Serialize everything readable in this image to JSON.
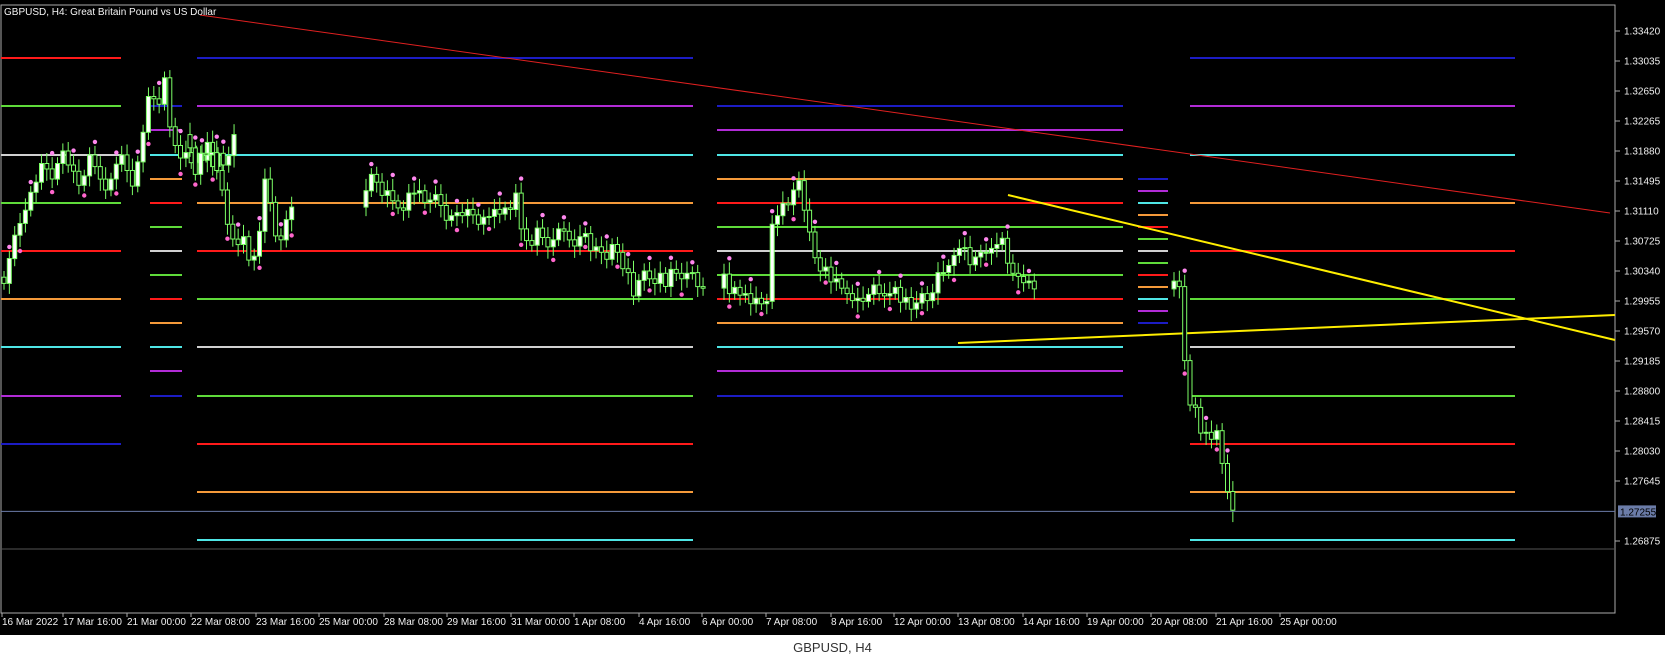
{
  "chart_data": {
    "type": "candlestick",
    "title": "GBPUSD, H4:  Great Britain Pound vs US Dollar",
    "caption": "GBPUSD, H4",
    "current_price": "1.27255",
    "y_ticks": [
      1.3342,
      1.33035,
      1.3265,
      1.32265,
      1.3188,
      1.31495,
      1.3111,
      1.30725,
      1.3034,
      1.29955,
      1.2957,
      1.29185,
      1.288,
      1.28415,
      1.2803,
      1.27645,
      1.26875
    ],
    "y_tick_labels": [
      "1.33420",
      "1.33035",
      "1.32650",
      "1.32265",
      "1.31880",
      "1.31495",
      "1.31110",
      "1.30725",
      "1.30340",
      "1.29955",
      "1.29570",
      "1.29185",
      "1.28800",
      "1.28415",
      "1.28030",
      "1.27645",
      "1.26875"
    ],
    "ylim": [
      1.2655,
      1.3365
    ],
    "x_labels": [
      "16 Mar 2022",
      "17 Mar 16:00",
      "21 Mar 00:00",
      "22 Mar 08:00",
      "23 Mar 16:00",
      "25 Mar 00:00",
      "28 Mar 08:00",
      "29 Mar 16:00",
      "31 Mar 00:00",
      "1 Apr 08:00",
      "4 Apr 16:00",
      "6 Apr 00:00",
      "7 Apr 08:00",
      "8 Apr 16:00",
      "12 Apr 00:00",
      "13 Apr 08:00",
      "14 Apr 16:00",
      "19 Apr 00:00",
      "20 Apr 08:00",
      "21 Apr 16:00",
      "25 Apr 00:00"
    ],
    "closes": [
      1.3018,
      1.305,
      1.308,
      1.3095,
      1.3112,
      1.3135,
      1.3148,
      1.3172,
      1.3165,
      1.3152,
      1.3172,
      1.3188,
      1.317,
      1.3162,
      1.3144,
      1.3156,
      1.3183,
      1.3168,
      1.3152,
      1.3138,
      1.3152,
      1.3171,
      1.3183,
      1.3163,
      1.3143,
      1.3174,
      1.3212,
      1.3258,
      1.3255,
      1.3248,
      1.3282,
      1.3219,
      1.3195,
      1.3179,
      1.3186,
      1.3173,
      1.3185,
      1.3176,
      1.3199,
      1.3168,
      1.3185,
      1.317,
      1.3182,
      1.3209,
      1.3192,
      1.3158,
      1.3185,
      1.3183,
      1.3186,
      1.3163,
      1.3138,
      1.3094,
      1.3075,
      1.3068,
      1.3078,
      1.3048,
      1.3053,
      1.3085,
      1.3152,
      1.3122,
      1.3079,
      1.3074,
      1.31,
      1.3116,
      1.3137,
      1.3158,
      1.3148,
      1.3131,
      1.3137,
      1.3124,
      1.3115,
      1.3112,
      1.3134,
      1.3134,
      1.3137,
      1.3122,
      1.3125,
      1.3132,
      1.3118,
      1.3099,
      1.3105,
      1.3109,
      1.3105,
      1.3113,
      1.3106,
      1.3094,
      1.3103,
      1.3104,
      1.3113,
      1.3107,
      1.3115,
      1.3113,
      1.3134,
      1.3088,
      1.3073,
      1.3067,
      1.3089,
      1.3077,
      1.3065,
      1.3074,
      1.3088,
      1.3085,
      1.3074,
      1.3066,
      1.3078,
      1.3082,
      1.306,
      1.3065,
      1.3058,
      1.3049,
      1.3068,
      1.3058,
      1.3037,
      1.3032,
      1.3002,
      1.3022,
      1.3034,
      1.3024,
      1.3018,
      1.3031,
      1.3014,
      1.3036,
      1.3031,
      1.3024,
      1.3031,
      1.3032,
      1.3014,
      1.3012,
      1.303,
      1.3005,
      1.3013,
      1.3003,
      1.3005,
      1.2992,
      1.2999,
      1.2992,
      1.2995,
      1.3094,
      1.3105,
      1.3121,
      1.3119,
      1.3138,
      1.315,
      1.3112,
      1.3084,
      1.3051,
      1.3034,
      1.3039,
      1.302,
      1.3024,
      1.3012,
      1.3005,
      1.2996,
      1.2999,
      1.2995,
      1.3004,
      1.3016,
      1.3005,
      1.3002,
      1.3005,
      1.3013,
      1.2994,
      1.3,
      1.2985,
      1.2993,
      1.3005,
      1.2996,
      1.3006,
      1.3032,
      1.3032,
      1.3041,
      1.3054,
      1.3063,
      1.3064,
      1.3042,
      1.3052,
      1.3058,
      1.3057,
      1.3063,
      1.3068,
      1.3076,
      1.3044,
      1.3031,
      1.3027,
      1.3019,
      1.3021,
      1.3011,
      1.3021,
      1.3014,
      1.2919,
      1.2862,
      1.2859,
      1.2826,
      1.2827,
      1.2818,
      1.2829,
      1.2787,
      1.2751,
      1.2727
    ]
  }
}
